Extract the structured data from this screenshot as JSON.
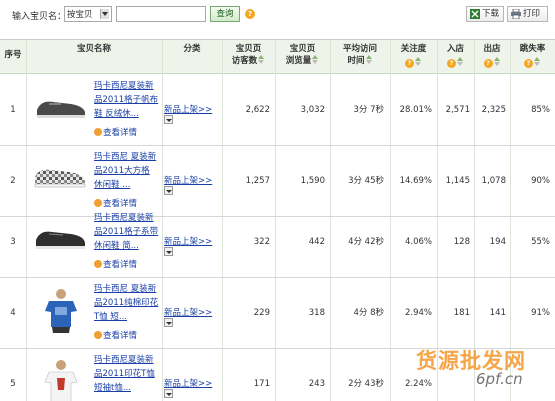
{
  "toolbar": {
    "label": "输入宝贝名：",
    "select_value": "按宝贝",
    "search_value": "",
    "query_label": "查询",
    "download_label": "下载",
    "print_label": "打印"
  },
  "columns": {
    "idx": "序号",
    "name": "宝贝名称",
    "category": "分类",
    "visitors_l1": "宝贝页",
    "visitors_l2": "访客数",
    "pv_l1": "宝贝页",
    "pv_l2": "浏览量",
    "avg_time_l1": "平均访问",
    "avg_time_l2": "时间",
    "attention": "关注度",
    "entry": "入店",
    "exit": "出店",
    "bounce": "跳失率"
  },
  "rows": [
    {
      "idx": "1",
      "name": "玛卡西尼夏装新品2011格子帆布鞋 反绒休...",
      "detail": "查看详情",
      "category": "新品上架>>",
      "visitors": "2,622",
      "pv": "3,032",
      "avg_time": "3分 7秒",
      "attention": "28.01%",
      "entry": "2,571",
      "exit": "2,325",
      "bounce": "85%",
      "thumb": "shoe-black-gray"
    },
    {
      "idx": "2",
      "name": "玛卡西尼 夏装新品2011大方格 休闲鞋 ...",
      "detail": "查看详情",
      "category": "新品上架>>",
      "visitors": "1,257",
      "pv": "1,590",
      "avg_time": "3分 45秒",
      "attention": "14.69%",
      "entry": "1,145",
      "exit": "1,078",
      "bounce": "90%",
      "thumb": "shoe-plaid"
    },
    {
      "idx": "3",
      "name": "玛卡西尼夏装新品2011格子系带休闲鞋 简...",
      "detail": "查看详情",
      "category": "新品上架>>",
      "visitors": "322",
      "pv": "442",
      "avg_time": "4分 42秒",
      "attention": "4.06%",
      "entry": "128",
      "exit": "194",
      "bounce": "55%",
      "thumb": "shoe-black"
    },
    {
      "idx": "4",
      "name": "玛卡西尼 夏装新品2011纯棉印花T恤 短...",
      "detail": "查看详情",
      "category": "新品上架>>",
      "visitors": "229",
      "pv": "318",
      "avg_time": "4分 8秒",
      "attention": "2.94%",
      "entry": "181",
      "exit": "141",
      "bounce": "91%",
      "thumb": "tshirt-blue"
    },
    {
      "idx": "5",
      "name": "玛卡西尼夏装新品2011印花T恤 短袖t恤...",
      "detail": "",
      "category": "新品上架>>",
      "visitors": "171",
      "pv": "243",
      "avg_time": "2分 43秒",
      "attention": "2.24%",
      "entry": "",
      "exit": "",
      "bounce": "",
      "thumb": "tshirt-white"
    }
  ],
  "watermark": {
    "cn": "货源批发网",
    "url": "6pf.cn"
  }
}
